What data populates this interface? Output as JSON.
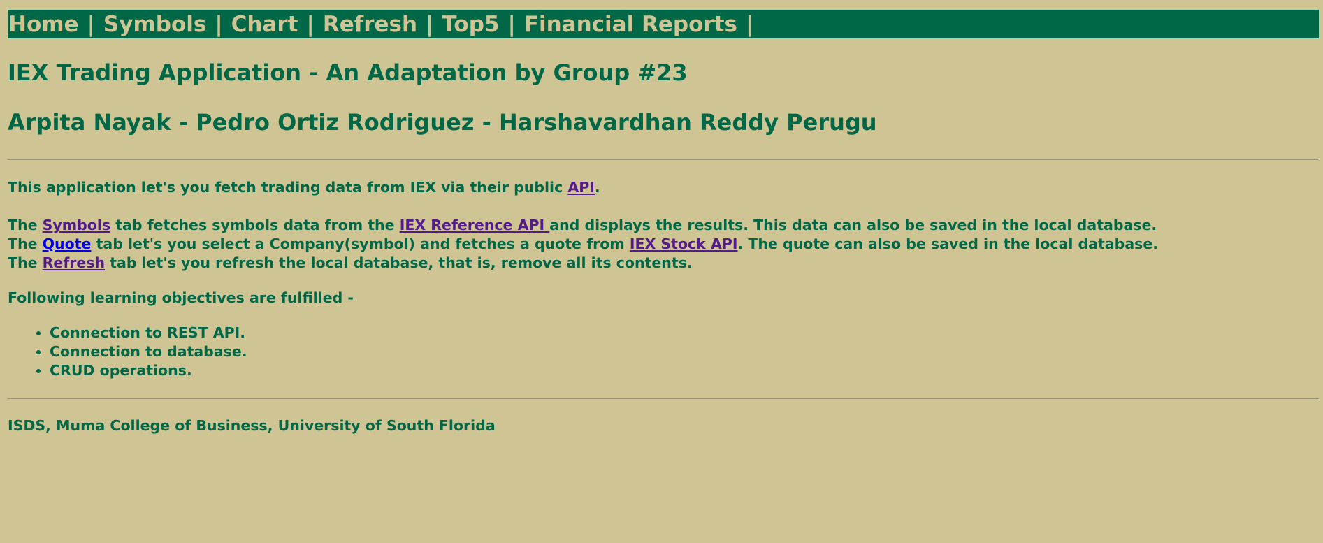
{
  "nav": {
    "items": [
      "Home",
      "Symbols",
      "Chart",
      "Refresh",
      "Top5",
      "Financial Reports"
    ],
    "separator": "|"
  },
  "header": {
    "title": "IEX Trading Application - An Adaptation by Group #23",
    "authors": "Arpita Nayak - Pedro Ortiz Rodriguez - Harshavardhan Reddy Perugu"
  },
  "intro": {
    "text": "This application let's you fetch trading data from IEX via their public ",
    "link": "API",
    "end": "."
  },
  "symbols_line": {
    "pre": "The ",
    "tab": "Symbols",
    "mid": " tab fetches symbols data from the ",
    "link": "IEX Reference API ",
    "post": "and displays the results. This data can also be saved in the local database."
  },
  "quote_line": {
    "pre": "The ",
    "tab": "Quote",
    "mid": " tab let's you select a Company(symbol) and fetches a quote from ",
    "link": "IEX Stock API",
    "post": ". The quote can also be saved in the local database."
  },
  "refresh_line": {
    "pre": "The ",
    "tab": "Refresh",
    "post": " tab let's you refresh the local database, that is, remove all its contents."
  },
  "objectives": {
    "heading": "Following learning objectives are fulfilled -",
    "items": [
      "Connection to REST API.",
      "Connection to database.",
      "CRUD operations."
    ]
  },
  "footer": {
    "text": "ISDS, Muma College of Business, University of South Florida"
  },
  "colors": {
    "background": "#cfc493",
    "primary_green": "#006747",
    "visited_link": "#551a8b",
    "active_link": "#0000ee"
  }
}
